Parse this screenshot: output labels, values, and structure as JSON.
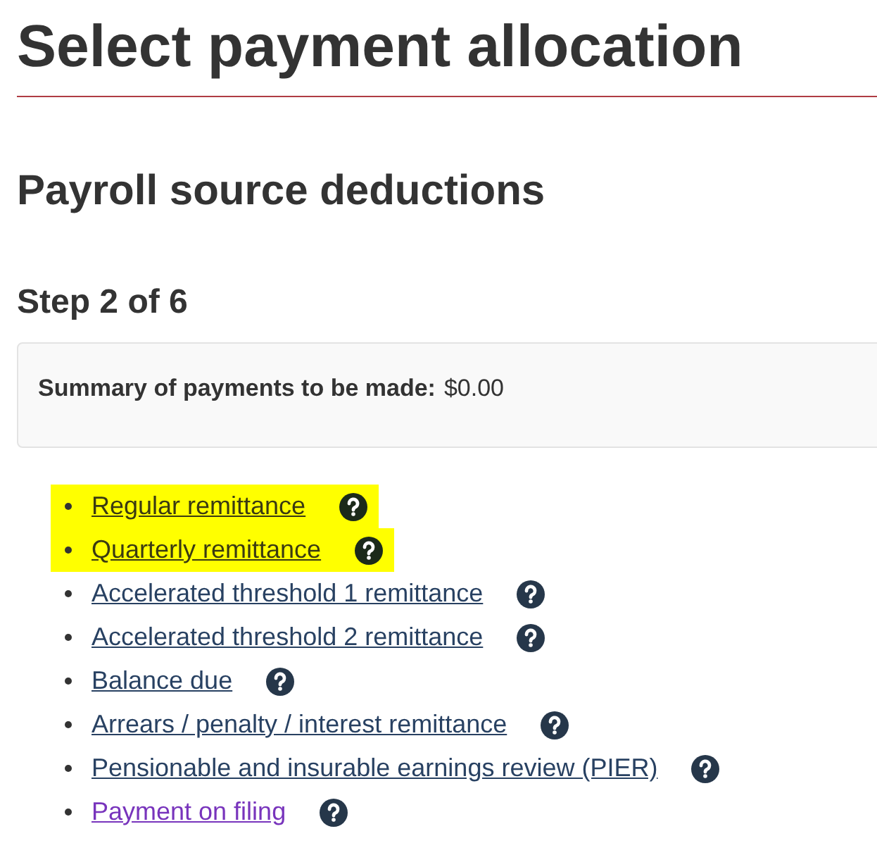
{
  "title": "Select payment allocation",
  "section_heading": "Payroll source deductions",
  "step": "Step 2 of 6",
  "summary": {
    "label": "Summary of payments to be made:",
    "value": "$0.00"
  },
  "options": [
    {
      "label": "Regular remittance",
      "highlighted": true,
      "visited": false
    },
    {
      "label": "Quarterly remittance",
      "highlighted": true,
      "visited": false
    },
    {
      "label": "Accelerated threshold 1 remittance",
      "highlighted": false,
      "visited": false
    },
    {
      "label": "Accelerated threshold 2 remittance",
      "highlighted": false,
      "visited": false
    },
    {
      "label": "Balance due",
      "highlighted": false,
      "visited": false
    },
    {
      "label": "Arrears / penalty / interest remittance",
      "highlighted": false,
      "visited": false
    },
    {
      "label": "Pensionable and insurable earnings review (PIER)",
      "highlighted": false,
      "visited": false
    },
    {
      "label": "Payment on filing",
      "highlighted": false,
      "visited": true
    }
  ]
}
